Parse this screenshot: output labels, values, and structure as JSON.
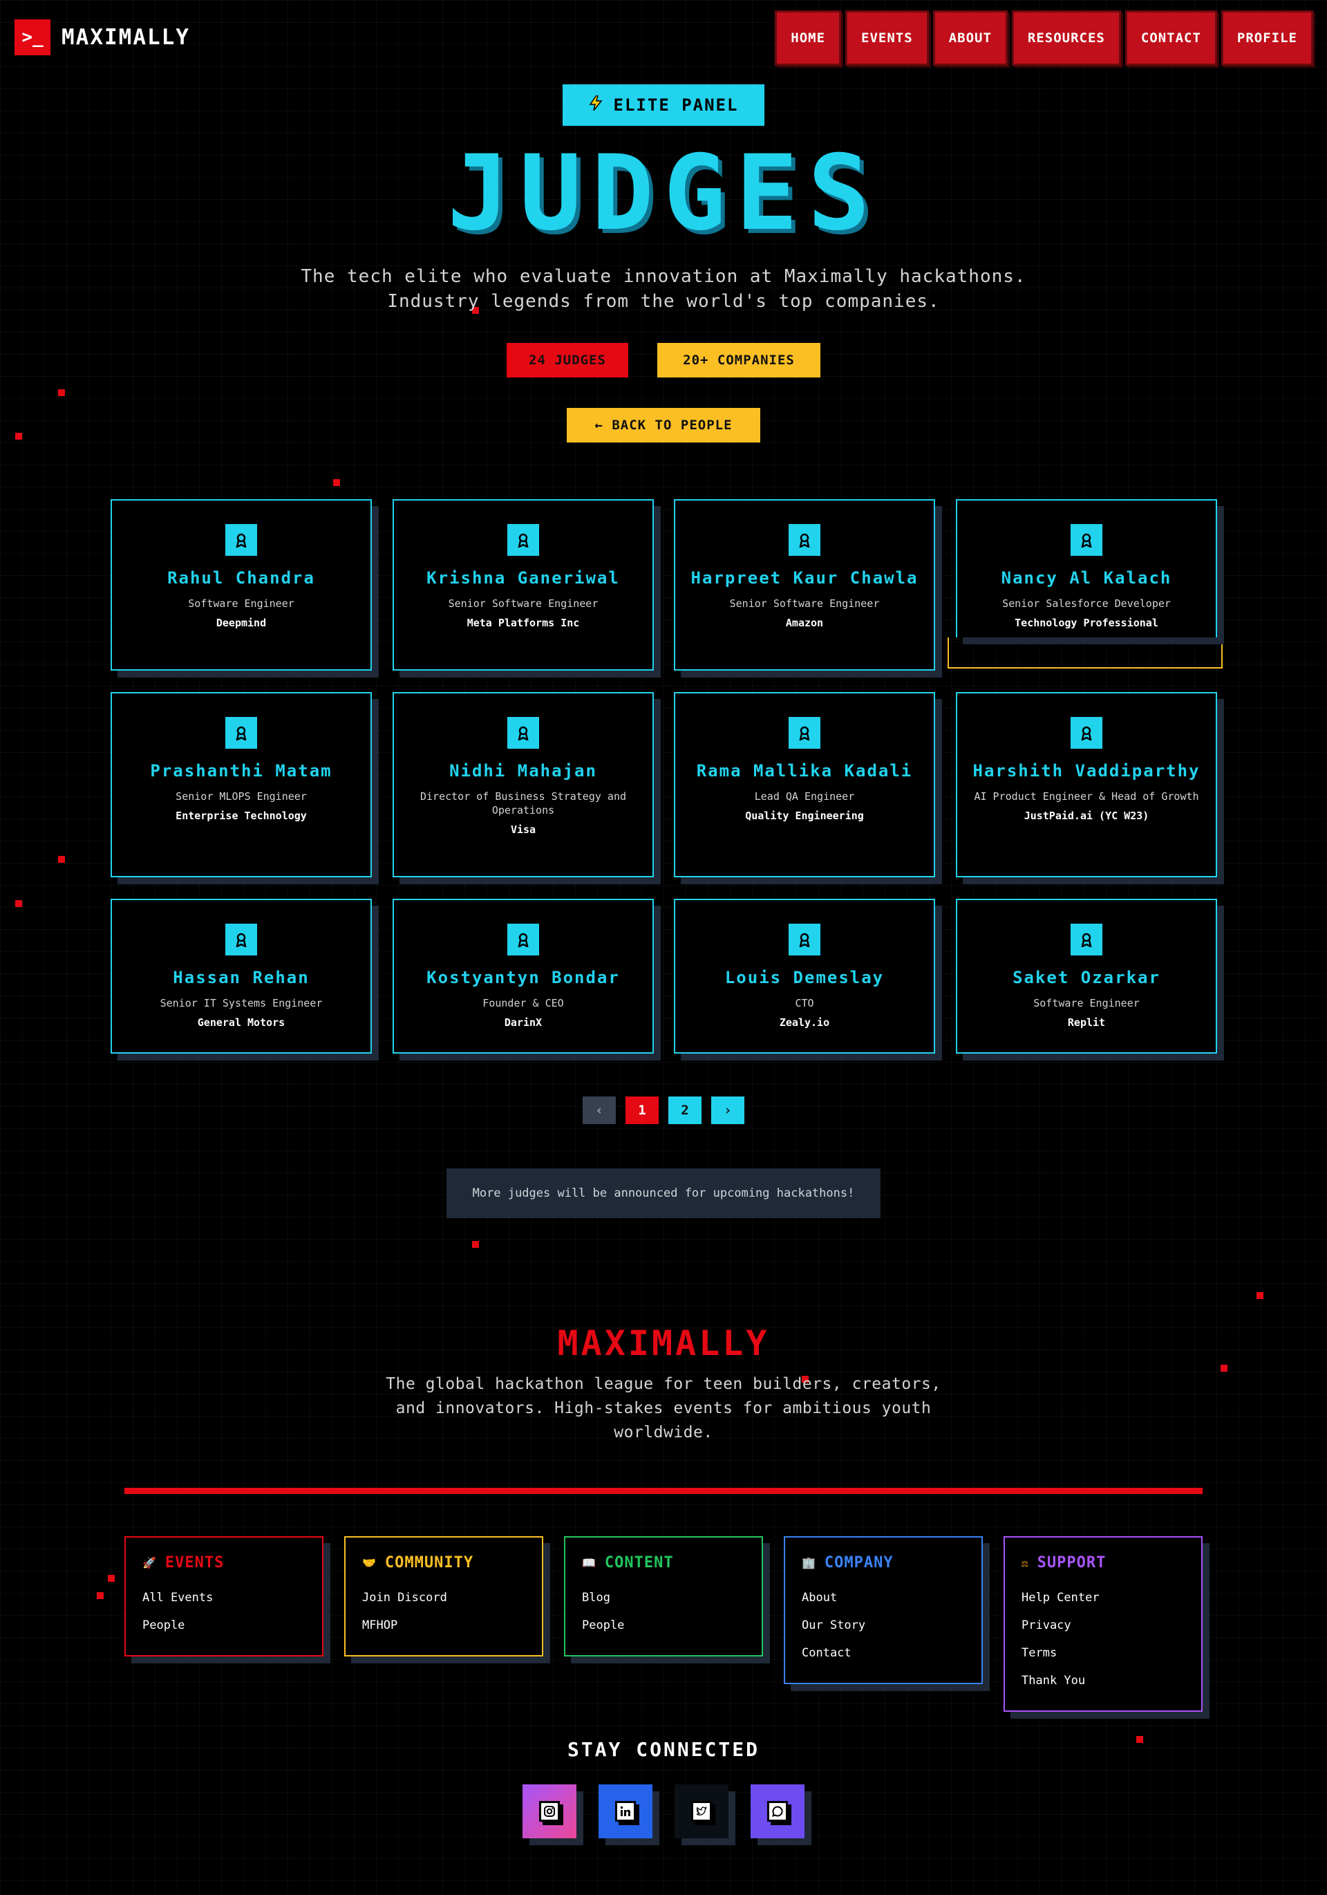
{
  "header": {
    "logo_glyph": ">_",
    "brand": "MAXIMALLY",
    "nav": [
      "HOME",
      "EVENTS",
      "ABOUT",
      "RESOURCES",
      "CONTACT",
      "PROFILE"
    ]
  },
  "hero": {
    "badge_icon": "lightning-icon",
    "badge": "ELITE PANEL",
    "title": "JUDGES",
    "subtitle": "The tech elite who evaluate innovation at Maximally hackathons. Industry legends from the world's top companies.",
    "stats": [
      "24 JUDGES",
      "20+ COMPANIES"
    ],
    "back_button": "← BACK TO PEOPLE"
  },
  "judges": [
    {
      "name": "Rahul Chandra",
      "role": "Software Engineer",
      "company": "Deepmind"
    },
    {
      "name": "Krishna Ganeriwal",
      "role": "Senior Software Engineer",
      "company": "Meta Platforms Inc"
    },
    {
      "name": "Harpreet Kaur Chawla",
      "role": "Senior Software Engineer",
      "company": "Amazon"
    },
    {
      "name": "Nancy Al Kalach",
      "role": "Senior Salesforce Developer",
      "company": "Technology Professional"
    },
    {
      "name": "Prashanthi Matam",
      "role": "Senior MLOPS Engineer",
      "company": "Enterprise Technology"
    },
    {
      "name": "Nidhi Mahajan",
      "role": "Director of Business Strategy and Operations",
      "company": "Visa"
    },
    {
      "name": "Rama Mallika Kadali",
      "role": "Lead QA Engineer",
      "company": "Quality Engineering"
    },
    {
      "name": "Harshith Vaddiparthy",
      "role": "AI Product Engineer & Head of Growth",
      "company": "JustPaid.ai (YC W23)"
    },
    {
      "name": "Hassan Rehan",
      "role": "Senior IT Systems Engineer",
      "company": "General Motors"
    },
    {
      "name": "Kostyantyn Bondar",
      "role": "Founder & CEO",
      "company": "DarinX"
    },
    {
      "name": "Louis Demeslay",
      "role": "CTO",
      "company": "Zealy.io"
    },
    {
      "name": "Saket Ozarkar",
      "role": "Software Engineer",
      "company": "Replit"
    }
  ],
  "pagination": {
    "prev": "‹",
    "pages": [
      "1",
      "2"
    ],
    "current": "1",
    "next": "›"
  },
  "notice": "More judges will be announced for upcoming hackathons!",
  "footer": {
    "brand": "MAXIMALLY",
    "tagline": "The global hackathon league for teen builders, creators, and innovators. High-stakes events for ambitious youth worldwide.",
    "columns": [
      {
        "title": "EVENTS",
        "icon": "rocket-icon",
        "glyph": "🚀",
        "links": [
          "All Events",
          "People"
        ]
      },
      {
        "title": "COMMUNITY",
        "icon": "heart-hands-icon",
        "glyph": "🤝",
        "links": [
          "Join Discord",
          "MFHOP"
        ]
      },
      {
        "title": "CONTENT",
        "icon": "book-icon",
        "glyph": "📖",
        "links": [
          "Blog",
          "People"
        ]
      },
      {
        "title": "COMPANY",
        "icon": "building-icon",
        "glyph": "🏢",
        "links": [
          "About",
          "Our Story",
          "Contact"
        ]
      },
      {
        "title": "SUPPORT",
        "icon": "scales-icon",
        "glyph": "⚖",
        "links": [
          "Help Center",
          "Privacy",
          "Terms",
          "Thank You"
        ]
      }
    ],
    "stay_connected": "STAY CONNECTED",
    "socials": [
      "instagram-icon",
      "linkedin-icon",
      "twitter-icon",
      "discord-icon"
    ]
  },
  "colors": {
    "red": "#e50914",
    "cyan": "#22d3ee",
    "yellow": "#fbbf24",
    "green": "#22c55e",
    "blue": "#3b82f6",
    "purple": "#a855f7"
  }
}
